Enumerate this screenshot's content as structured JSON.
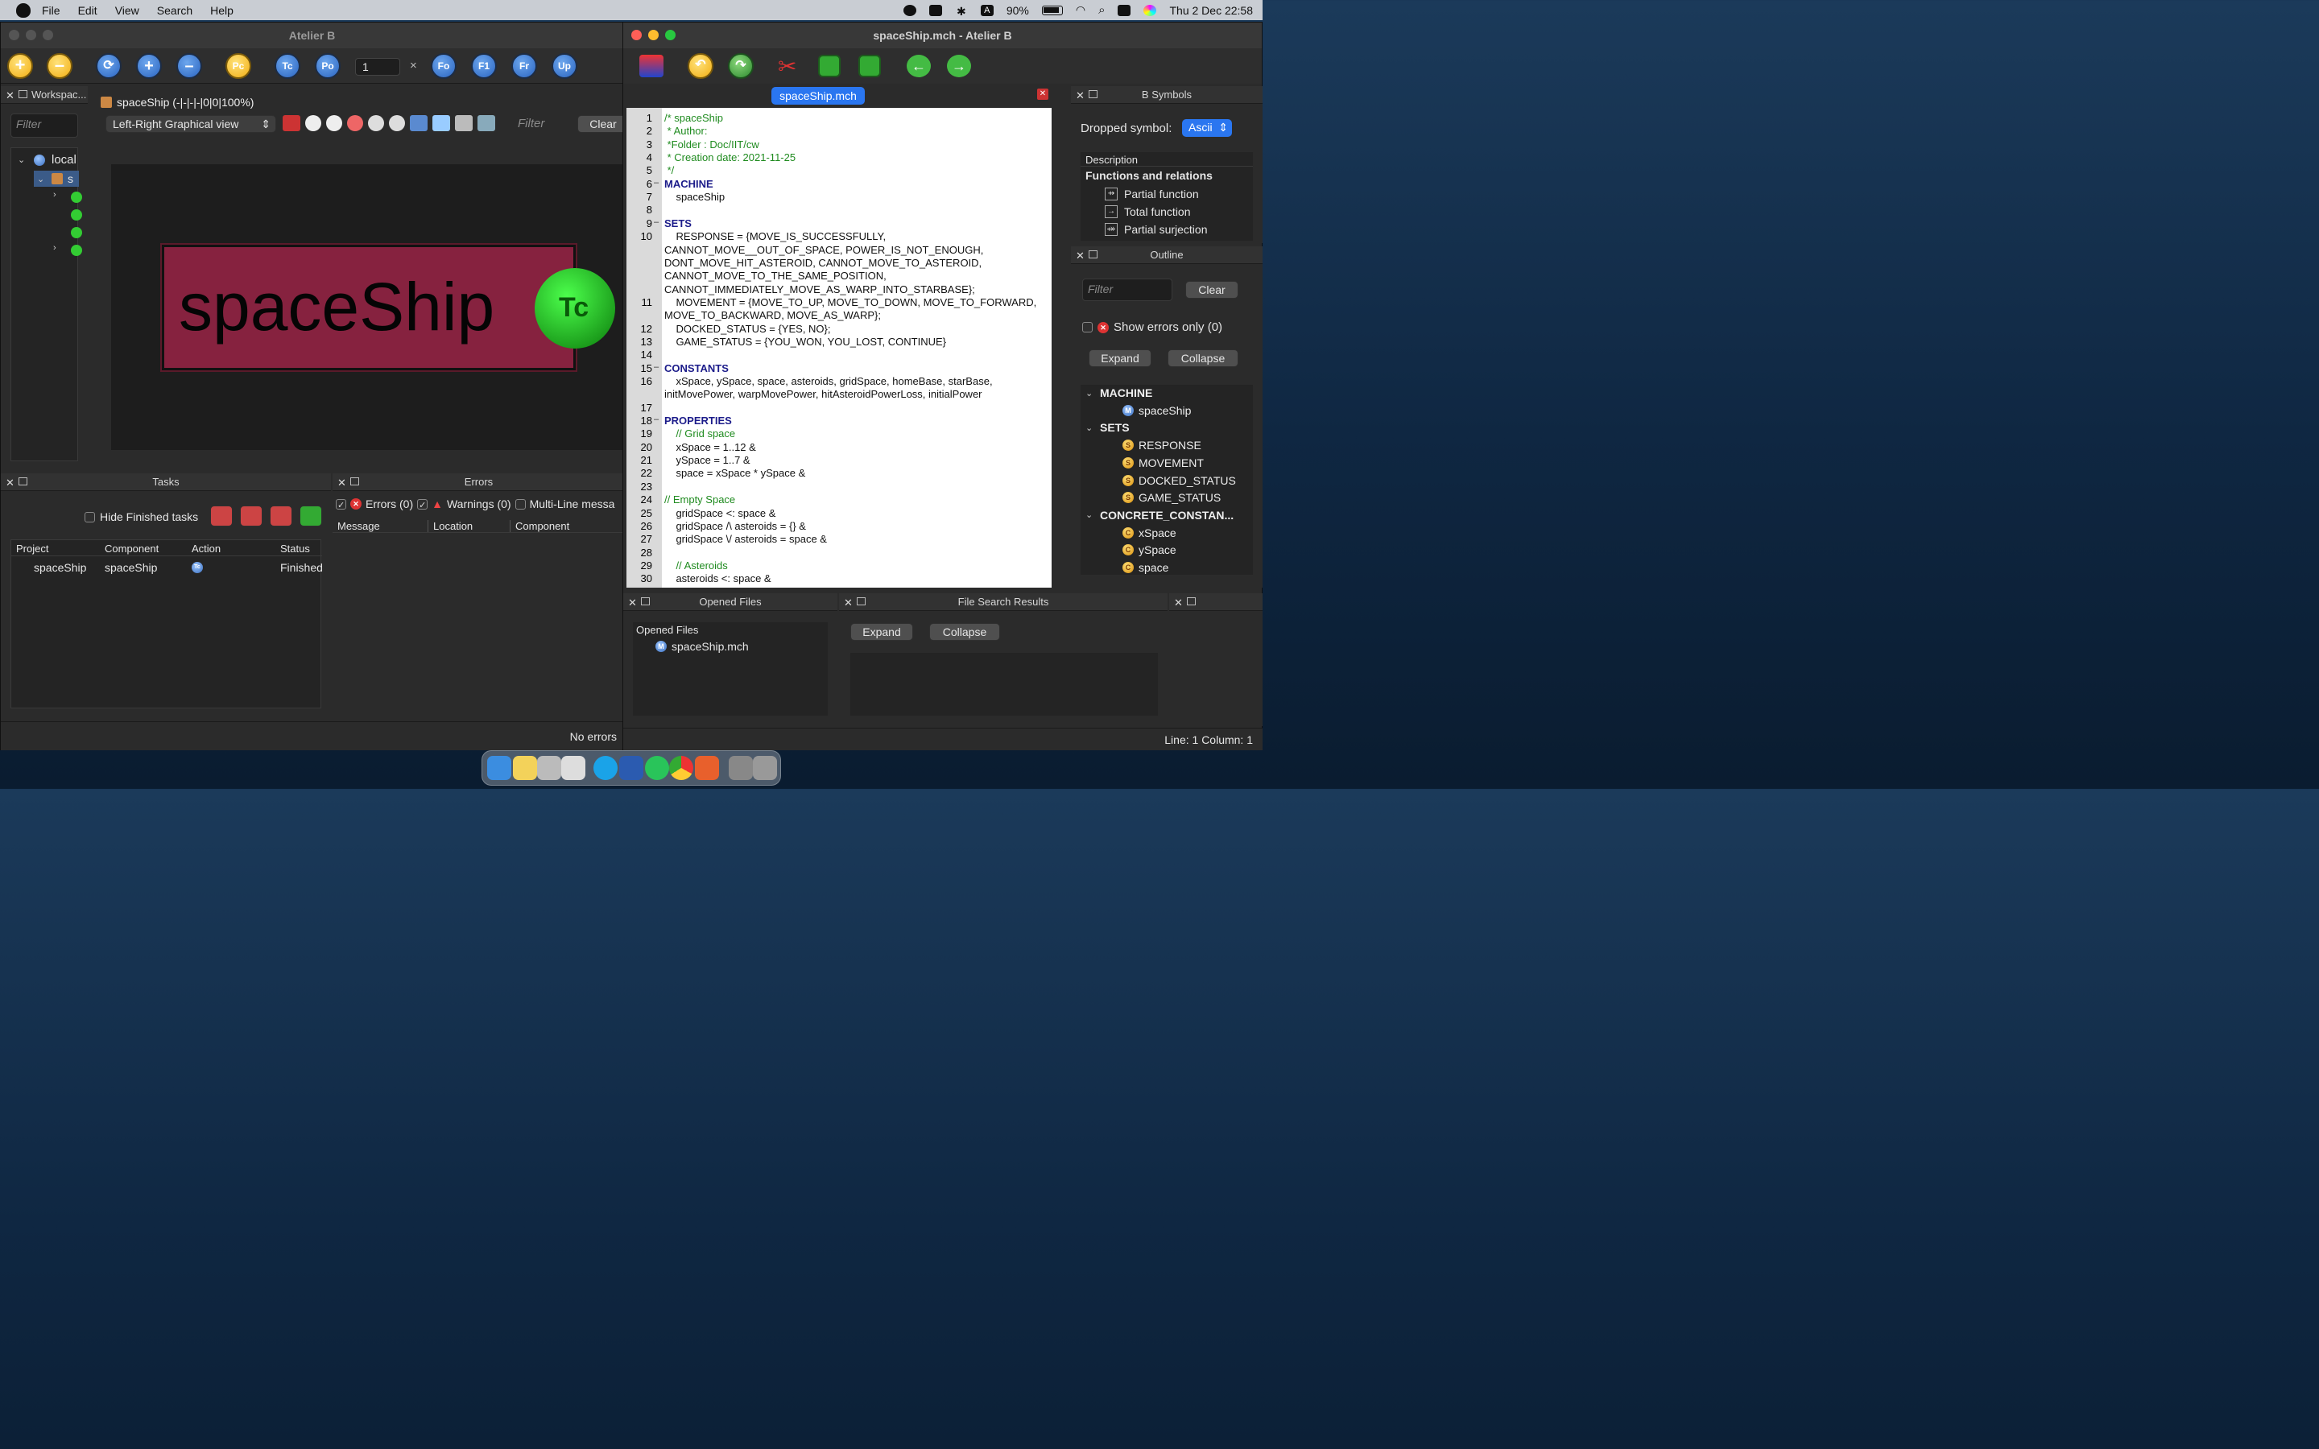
{
  "menubar": {
    "items": [
      "File",
      "Edit",
      "View",
      "Search",
      "Help"
    ],
    "battery": "90%",
    "clock": "Thu 2 Dec  22:58"
  },
  "left_window": {
    "title": "Atelier B",
    "spinner_value": "1",
    "toolbar_buttons": [
      "Pc",
      "Tc",
      "Po",
      "Fo",
      "F1",
      "Fr",
      "Up"
    ],
    "workspace": {
      "title": "Workspac...",
      "filter_placeholder": "Filter",
      "root": "local",
      "child": "s"
    },
    "graph": {
      "header": "spaceShip (-|-|-|-|0|0|100%)",
      "view_mode": "Left-Right Graphical view",
      "filter_placeholder": "Filter",
      "clear_label": "Clear",
      "node_label": "spaceShip",
      "node_badge": "Tc"
    },
    "tasks": {
      "title": "Tasks",
      "hide_finished_label": "Hide Finished tasks",
      "columns": [
        "Project",
        "Component",
        "Action",
        "Status"
      ],
      "rows": [
        {
          "project": "spaceShip",
          "component": "spaceShip",
          "action": "Tc",
          "status": "Finished"
        }
      ]
    },
    "errors": {
      "title": "Errors",
      "errors_label": "Errors (0)",
      "warnings_label": "Warnings (0)",
      "multiline_label": "Multi-Line messa",
      "columns": [
        "Message",
        "Location",
        "Component"
      ],
      "status": "No errors"
    }
  },
  "right_window": {
    "title": "spaceShip.mch - Atelier B",
    "tab": "spaceShip.mch",
    "code_lines": [
      {
        "n": "1",
        "fold": "",
        "cls": "cm",
        "text": "/* spaceShip"
      },
      {
        "n": "2",
        "fold": "",
        "cls": "cm",
        "text": " * Author:"
      },
      {
        "n": "3",
        "fold": "",
        "cls": "cm",
        "text": " *Folder : Doc/IIT/cw"
      },
      {
        "n": "4",
        "fold": "",
        "cls": "cm",
        "text": " * Creation date: 2021-11-25"
      },
      {
        "n": "5",
        "fold": "",
        "cls": "cm",
        "text": " */"
      },
      {
        "n": "6",
        "fold": "–",
        "cls": "kw",
        "text": "MACHINE"
      },
      {
        "n": "7",
        "fold": "",
        "cls": "",
        "text": "    spaceShip"
      },
      {
        "n": "8",
        "fold": "",
        "cls": "",
        "text": ""
      },
      {
        "n": "9",
        "fold": "–",
        "cls": "kw",
        "text": "SETS"
      },
      {
        "n": "10",
        "fold": "",
        "cls": "",
        "text": "    RESPONSE = {MOVE_IS_SUCCESSFULLY,"
      },
      {
        "n": "",
        "fold": "",
        "cls": "",
        "text": "CANNOT_MOVE__OUT_OF_SPACE, POWER_IS_NOT_ENOUGH,"
      },
      {
        "n": "",
        "fold": "",
        "cls": "",
        "text": "DONT_MOVE_HIT_ASTEROID, CANNOT_MOVE_TO_ASTEROID,"
      },
      {
        "n": "",
        "fold": "",
        "cls": "",
        "text": "CANNOT_MOVE_TO_THE_SAME_POSITION,"
      },
      {
        "n": "",
        "fold": "",
        "cls": "",
        "text": "CANNOT_IMMEDIATELY_MOVE_AS_WARP_INTO_STARBASE};"
      },
      {
        "n": "11",
        "fold": "",
        "cls": "",
        "text": "    MOVEMENT = {MOVE_TO_UP, MOVE_TO_DOWN, MOVE_TO_FORWARD,"
      },
      {
        "n": "",
        "fold": "",
        "cls": "",
        "text": "MOVE_TO_BACKWARD, MOVE_AS_WARP};"
      },
      {
        "n": "12",
        "fold": "",
        "cls": "",
        "text": "    DOCKED_STATUS = {YES, NO};"
      },
      {
        "n": "13",
        "fold": "",
        "cls": "",
        "text": "    GAME_STATUS = {YOU_WON, YOU_LOST, CONTINUE}"
      },
      {
        "n": "14",
        "fold": "",
        "cls": "",
        "text": ""
      },
      {
        "n": "15",
        "fold": "–",
        "cls": "kw",
        "text": "CONSTANTS"
      },
      {
        "n": "16",
        "fold": "",
        "cls": "",
        "text": "    xSpace, ySpace, space, asteroids, gridSpace, homeBase, starBase,"
      },
      {
        "n": "",
        "fold": "",
        "cls": "",
        "text": "initMovePower, warpMovePower, hitAsteroidPowerLoss, initialPower"
      },
      {
        "n": "17",
        "fold": "",
        "cls": "",
        "text": ""
      },
      {
        "n": "18",
        "fold": "–",
        "cls": "kw",
        "text": "PROPERTIES"
      },
      {
        "n": "19",
        "fold": "",
        "cls": "cm",
        "text": "    // Grid space"
      },
      {
        "n": "20",
        "fold": "",
        "cls": "",
        "text": "    xSpace = 1..12 &"
      },
      {
        "n": "21",
        "fold": "",
        "cls": "",
        "text": "    ySpace = 1..7 &"
      },
      {
        "n": "22",
        "fold": "",
        "cls": "",
        "text": "    space = xSpace * ySpace &"
      },
      {
        "n": "23",
        "fold": "",
        "cls": "",
        "text": ""
      },
      {
        "n": "24",
        "fold": "",
        "cls": "cm",
        "text": "// Empty Space"
      },
      {
        "n": "25",
        "fold": "",
        "cls": "",
        "text": "    gridSpace <: space &"
      },
      {
        "n": "26",
        "fold": "",
        "cls": "",
        "text": "    gridSpace /\\ asteroids = {} &"
      },
      {
        "n": "27",
        "fold": "",
        "cls": "",
        "text": "    gridSpace \\/ asteroids = space &"
      },
      {
        "n": "28",
        "fold": "",
        "cls": "",
        "text": ""
      },
      {
        "n": "29",
        "fold": "",
        "cls": "cm",
        "text": "    // Asteroids"
      },
      {
        "n": "30",
        "fold": "",
        "cls": "",
        "text": "    asteroids <: space &"
      }
    ],
    "bsymbols": {
      "title": "B Symbols",
      "dropped_label": "Dropped symbol:",
      "dropped_value": "Ascii",
      "description_header": "Description",
      "group": "Functions and relations",
      "items": [
        {
          "glyph": "⇸",
          "label": "Partial function"
        },
        {
          "glyph": "→",
          "label": "Total function"
        },
        {
          "glyph": "⤀",
          "label": "Partial surjection"
        }
      ]
    },
    "outline": {
      "title": "Outline",
      "filter_placeholder": "Filter",
      "clear_label": "Clear",
      "show_errors_label": "Show errors only (0)",
      "expand_label": "Expand",
      "collapse_label": "Collapse",
      "tree": [
        {
          "kind": "section",
          "label": "MACHINE"
        },
        {
          "kind": "m",
          "label": "spaceShip"
        },
        {
          "kind": "section",
          "label": "SETS"
        },
        {
          "kind": "s",
          "label": "RESPONSE"
        },
        {
          "kind": "s",
          "label": "MOVEMENT"
        },
        {
          "kind": "s",
          "label": "DOCKED_STATUS"
        },
        {
          "kind": "s",
          "label": "GAME_STATUS"
        },
        {
          "kind": "section",
          "label": "CONCRETE_CONSTAN..."
        },
        {
          "kind": "c",
          "label": "xSpace"
        },
        {
          "kind": "c",
          "label": "ySpace"
        },
        {
          "kind": "c",
          "label": "space"
        }
      ]
    },
    "opened_files": {
      "title": "Opened Files",
      "header": "Opened Files",
      "file": "spaceShip.mch"
    },
    "file_search": {
      "title": "File Search Results",
      "expand_label": "Expand",
      "collapse_label": "Collapse"
    },
    "statusbar": "Line: 1  Column: 1"
  }
}
